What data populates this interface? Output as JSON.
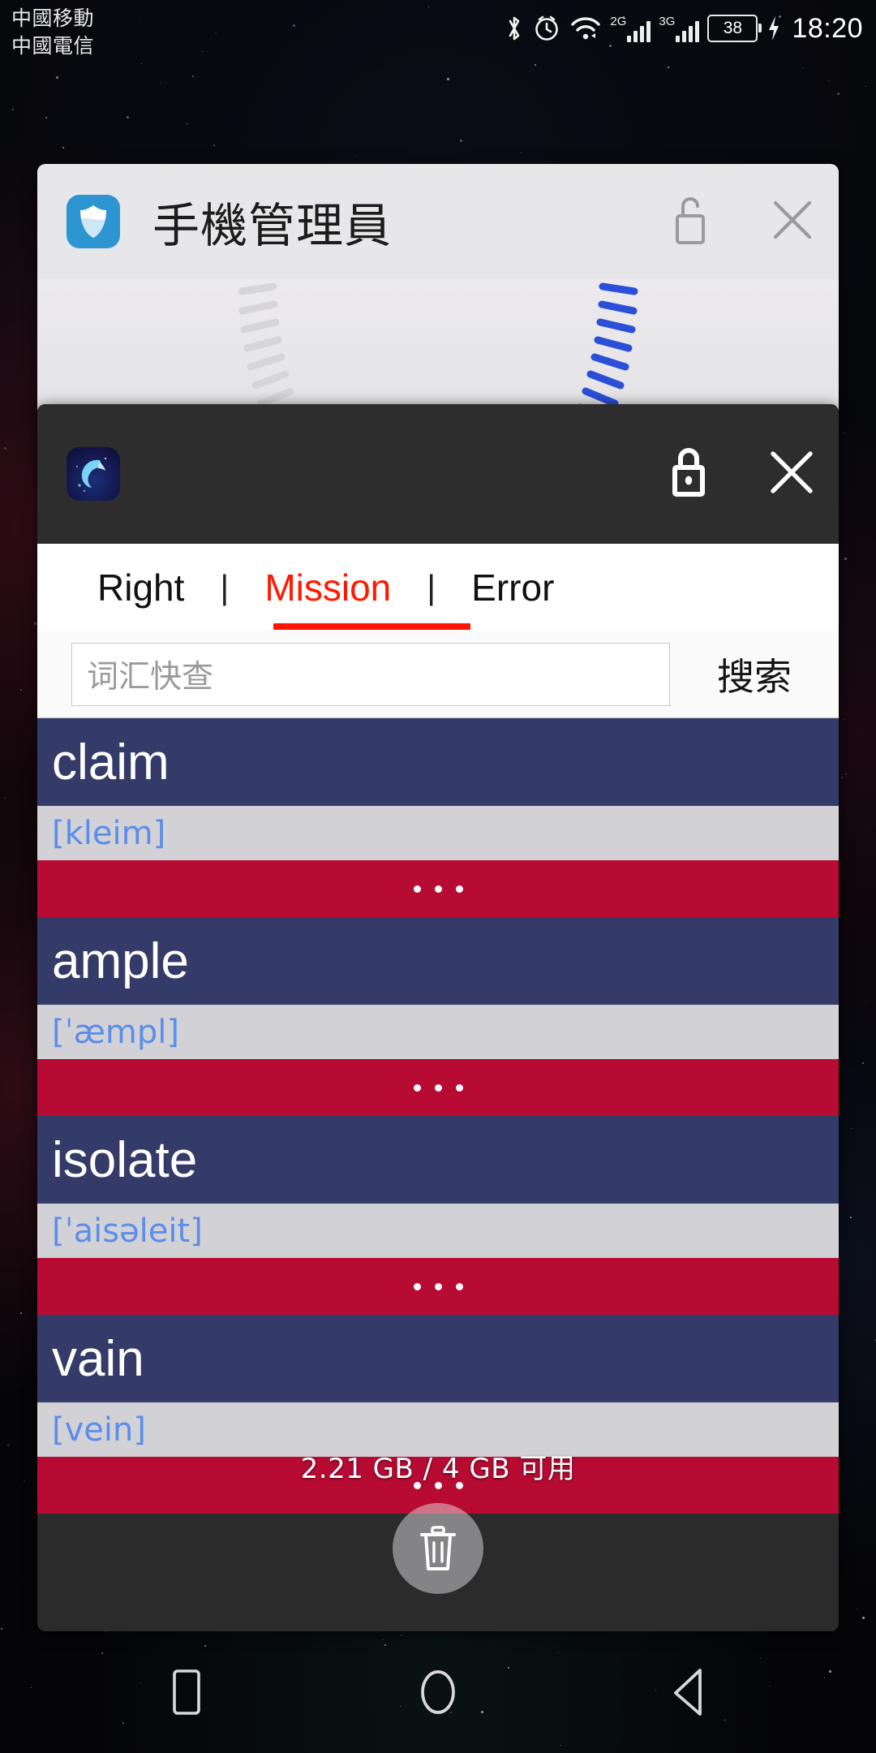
{
  "status_bar": {
    "carrier_primary": "中國移動",
    "carrier_secondary": "中國電信",
    "icons": [
      "bluetooth-icon",
      "alarm-icon",
      "wifi-icon",
      "signal-2g-icon",
      "signal-3g-icon",
      "battery-icon",
      "charging-icon"
    ],
    "signal_2g_label": "2G",
    "signal_3g_label": "3G",
    "battery_level": "38",
    "clock": "18:20"
  },
  "recents": {
    "memory_status": "2.21 GB /  4 GB 可用",
    "clear_all_icon": "trash-icon",
    "cards": [
      {
        "title": "手機管理員",
        "app_icon": "shield-icon",
        "lock_icon": "unlock-icon",
        "lock_state": "unlocked",
        "close_icon": "close-icon",
        "accent": "#2e95d3"
      },
      {
        "title": "",
        "app_icon": "dolphin-icon",
        "lock_icon": "lock-icon",
        "lock_state": "locked",
        "close_icon": "close-icon",
        "accent": "#1b2f7a"
      }
    ]
  },
  "dictionary_app": {
    "tabs": [
      {
        "label": "Right",
        "active": false
      },
      {
        "label": "Mission",
        "active": true
      },
      {
        "label": "Error",
        "active": false
      }
    ],
    "tab_separator": "|",
    "active_tab_color": "#ff1900",
    "search": {
      "placeholder": "词汇快查",
      "value": "",
      "button_label": "搜索"
    },
    "more_indicator": "...",
    "words": [
      {
        "term": "claim",
        "phonetic": "[kleim]"
      },
      {
        "term": "ample",
        "phonetic": "[ˈæmpl]"
      },
      {
        "term": "isolate",
        "phonetic": "[ˈaisəleit]"
      },
      {
        "term": "vain",
        "phonetic": "[vein]"
      }
    ],
    "colors": {
      "term_bg": "#343b68",
      "phonetic_bg": "#d2d2d6",
      "phonetic_fg": "#5b8dea",
      "more_bg": "#b80b33"
    }
  },
  "nav_bar": {
    "buttons": [
      {
        "name": "recents-button",
        "icon": "square-icon"
      },
      {
        "name": "home-button",
        "icon": "circle-icon"
      },
      {
        "name": "back-button",
        "icon": "triangle-left-icon"
      }
    ]
  }
}
